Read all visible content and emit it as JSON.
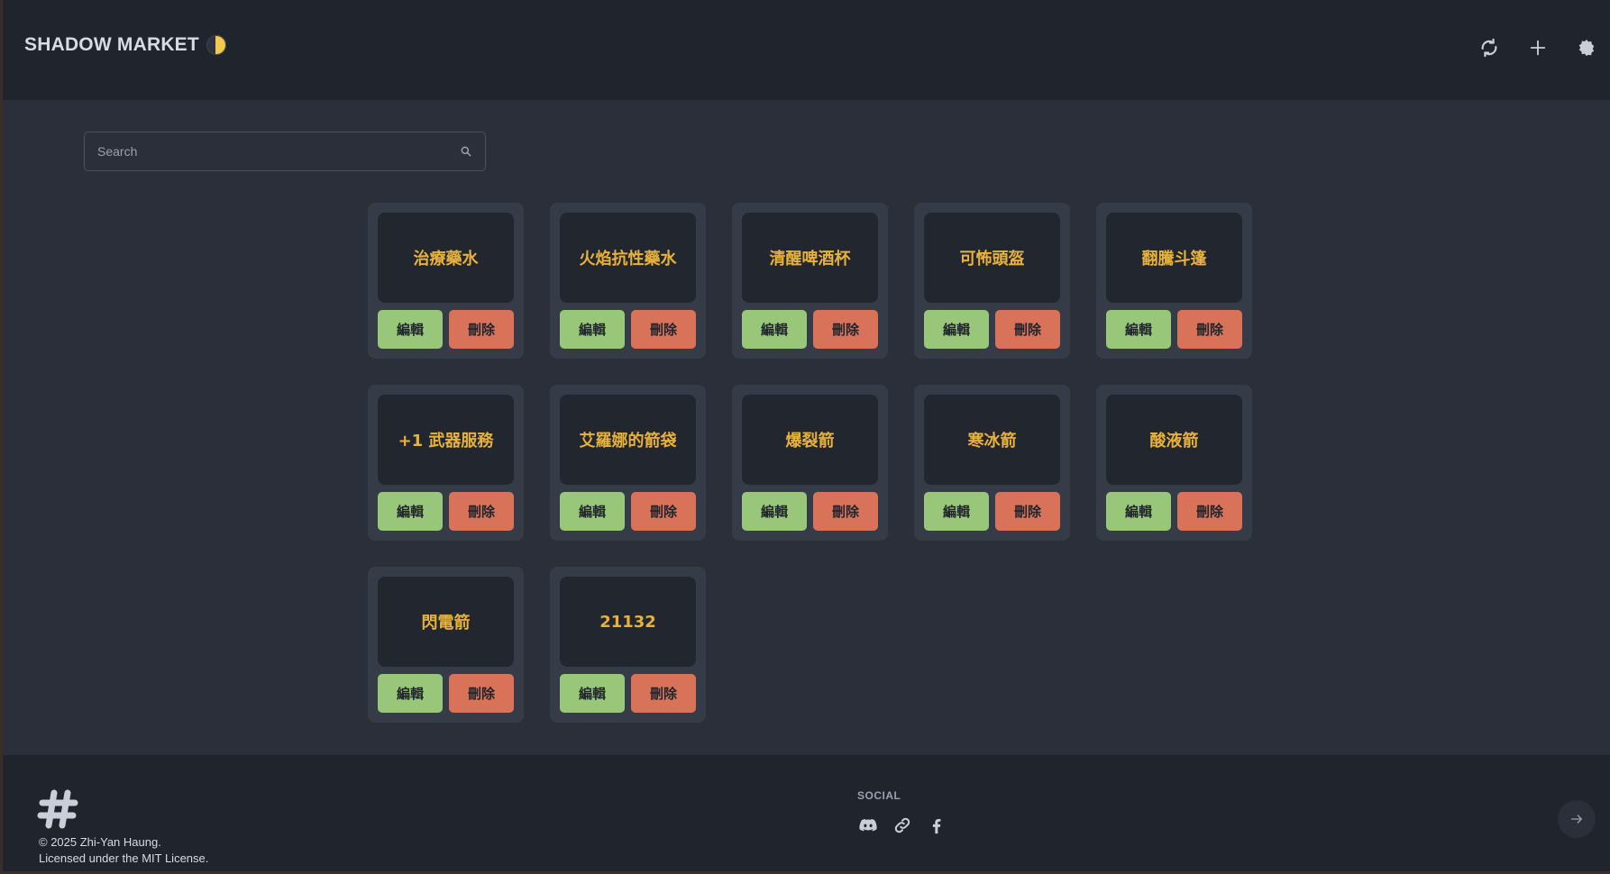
{
  "header": {
    "brand": "SHADOW MARKET",
    "icons": [
      "refresh-icon",
      "plus-icon",
      "settings-icon"
    ]
  },
  "search": {
    "placeholder": "Search"
  },
  "items": [
    {
      "name": "治療藥水",
      "edit": "編輯",
      "delete": "刪除"
    },
    {
      "name": "火焰抗性藥水",
      "edit": "編輯",
      "delete": "刪除"
    },
    {
      "name": "清醒啤酒杯",
      "edit": "編輯",
      "delete": "刪除"
    },
    {
      "name": "可怖頭盔",
      "edit": "編輯",
      "delete": "刪除"
    },
    {
      "name": "翻騰斗篷",
      "edit": "編輯",
      "delete": "刪除"
    },
    {
      "name": "+1 武器服務",
      "edit": "編輯",
      "delete": "刪除"
    },
    {
      "name": "艾羅娜的箭袋",
      "edit": "編輯",
      "delete": "刪除"
    },
    {
      "name": "爆裂箭",
      "edit": "編輯",
      "delete": "刪除"
    },
    {
      "name": "寒冰箭",
      "edit": "編輯",
      "delete": "刪除"
    },
    {
      "name": "酸液箭",
      "edit": "編輯",
      "delete": "刪除"
    },
    {
      "name": "閃電箭",
      "edit": "編輯",
      "delete": "刪除"
    },
    {
      "name": "21132",
      "edit": "編輯",
      "delete": "刪除"
    }
  ],
  "footer": {
    "copyright": "© 2025 Zhi-Yan Haung.",
    "license": "Licensed under the MIT License.",
    "social_title": "SOCIAL",
    "social_icons": [
      "discord-icon",
      "link-icon",
      "facebook-icon"
    ]
  },
  "colors": {
    "header_bg": "#20242c",
    "page_bg": "#2b2f3a",
    "card_bg": "#363b48",
    "title_gold": "#e8b23a",
    "edit_green": "#99c77a",
    "delete_red": "#d8735a"
  }
}
